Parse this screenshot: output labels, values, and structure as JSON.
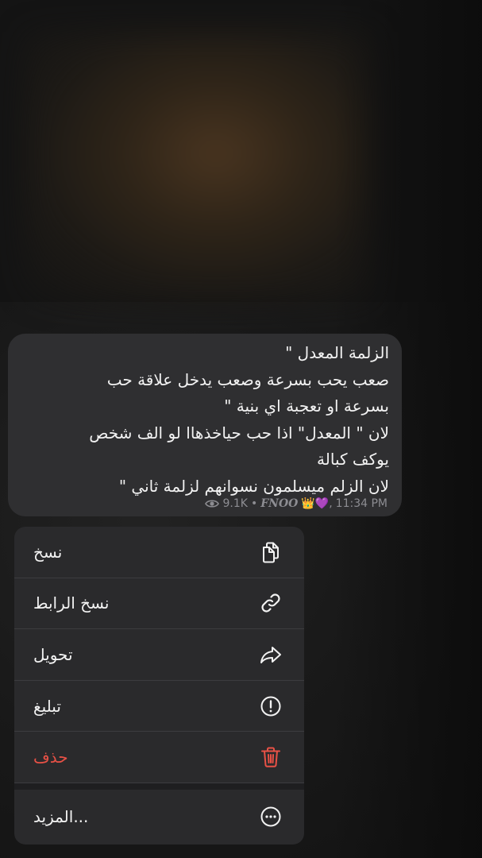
{
  "message": {
    "lines": [
      "الزلمة المعدل \"",
      "صعب يحب بسرعة وصعب يدخل علاقة حب",
      "بسرعة او تعجبة اي بنية \"",
      "لان \" المعدل\" اذا حب حياخذهاا لو الف شخص",
      "يوكف كبالة",
      "لان الزلم ميسلمون نسوانهم لزلمة ثاني \""
    ],
    "views": "9.1K",
    "separator": "•",
    "author": "FNOO",
    "emojis": "👑💜,",
    "time": "11:34 PM"
  },
  "menu": {
    "items": [
      {
        "label": "نسخ",
        "icon": "copy-icon"
      },
      {
        "label": "نسخ الرابط",
        "icon": "link-icon"
      },
      {
        "label": "تحويل",
        "icon": "forward-icon"
      },
      {
        "label": "تبليغ",
        "icon": "report-icon"
      },
      {
        "label": "حذف",
        "icon": "trash-icon",
        "color": "#e85146"
      },
      {
        "label": "المزيد...",
        "icon": "more-icon"
      }
    ]
  }
}
